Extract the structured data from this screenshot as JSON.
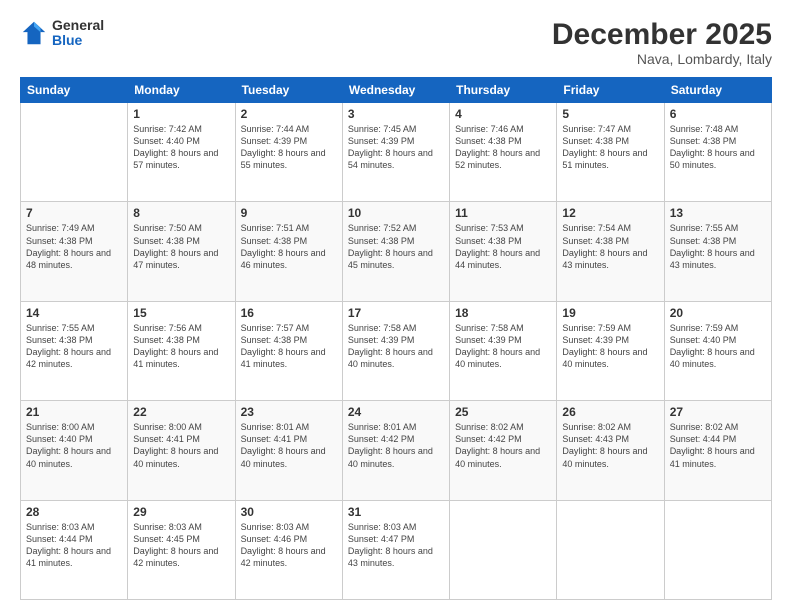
{
  "header": {
    "logo_general": "General",
    "logo_blue": "Blue",
    "month": "December 2025",
    "location": "Nava, Lombardy, Italy"
  },
  "days_of_week": [
    "Sunday",
    "Monday",
    "Tuesday",
    "Wednesday",
    "Thursday",
    "Friday",
    "Saturday"
  ],
  "weeks": [
    [
      {
        "day": "",
        "sunrise": "",
        "sunset": "",
        "daylight": ""
      },
      {
        "day": "1",
        "sunrise": "7:42 AM",
        "sunset": "4:40 PM",
        "daylight": "8 hours and 57 minutes."
      },
      {
        "day": "2",
        "sunrise": "7:44 AM",
        "sunset": "4:39 PM",
        "daylight": "8 hours and 55 minutes."
      },
      {
        "day": "3",
        "sunrise": "7:45 AM",
        "sunset": "4:39 PM",
        "daylight": "8 hours and 54 minutes."
      },
      {
        "day": "4",
        "sunrise": "7:46 AM",
        "sunset": "4:38 PM",
        "daylight": "8 hours and 52 minutes."
      },
      {
        "day": "5",
        "sunrise": "7:47 AM",
        "sunset": "4:38 PM",
        "daylight": "8 hours and 51 minutes."
      },
      {
        "day": "6",
        "sunrise": "7:48 AM",
        "sunset": "4:38 PM",
        "daylight": "8 hours and 50 minutes."
      }
    ],
    [
      {
        "day": "7",
        "sunrise": "7:49 AM",
        "sunset": "4:38 PM",
        "daylight": "8 hours and 48 minutes."
      },
      {
        "day": "8",
        "sunrise": "7:50 AM",
        "sunset": "4:38 PM",
        "daylight": "8 hours and 47 minutes."
      },
      {
        "day": "9",
        "sunrise": "7:51 AM",
        "sunset": "4:38 PM",
        "daylight": "8 hours and 46 minutes."
      },
      {
        "day": "10",
        "sunrise": "7:52 AM",
        "sunset": "4:38 PM",
        "daylight": "8 hours and 45 minutes."
      },
      {
        "day": "11",
        "sunrise": "7:53 AM",
        "sunset": "4:38 PM",
        "daylight": "8 hours and 44 minutes."
      },
      {
        "day": "12",
        "sunrise": "7:54 AM",
        "sunset": "4:38 PM",
        "daylight": "8 hours and 43 minutes."
      },
      {
        "day": "13",
        "sunrise": "7:55 AM",
        "sunset": "4:38 PM",
        "daylight": "8 hours and 43 minutes."
      }
    ],
    [
      {
        "day": "14",
        "sunrise": "7:55 AM",
        "sunset": "4:38 PM",
        "daylight": "8 hours and 42 minutes."
      },
      {
        "day": "15",
        "sunrise": "7:56 AM",
        "sunset": "4:38 PM",
        "daylight": "8 hours and 41 minutes."
      },
      {
        "day": "16",
        "sunrise": "7:57 AM",
        "sunset": "4:38 PM",
        "daylight": "8 hours and 41 minutes."
      },
      {
        "day": "17",
        "sunrise": "7:58 AM",
        "sunset": "4:39 PM",
        "daylight": "8 hours and 40 minutes."
      },
      {
        "day": "18",
        "sunrise": "7:58 AM",
        "sunset": "4:39 PM",
        "daylight": "8 hours and 40 minutes."
      },
      {
        "day": "19",
        "sunrise": "7:59 AM",
        "sunset": "4:39 PM",
        "daylight": "8 hours and 40 minutes."
      },
      {
        "day": "20",
        "sunrise": "7:59 AM",
        "sunset": "4:40 PM",
        "daylight": "8 hours and 40 minutes."
      }
    ],
    [
      {
        "day": "21",
        "sunrise": "8:00 AM",
        "sunset": "4:40 PM",
        "daylight": "8 hours and 40 minutes."
      },
      {
        "day": "22",
        "sunrise": "8:00 AM",
        "sunset": "4:41 PM",
        "daylight": "8 hours and 40 minutes."
      },
      {
        "day": "23",
        "sunrise": "8:01 AM",
        "sunset": "4:41 PM",
        "daylight": "8 hours and 40 minutes."
      },
      {
        "day": "24",
        "sunrise": "8:01 AM",
        "sunset": "4:42 PM",
        "daylight": "8 hours and 40 minutes."
      },
      {
        "day": "25",
        "sunrise": "8:02 AM",
        "sunset": "4:42 PM",
        "daylight": "8 hours and 40 minutes."
      },
      {
        "day": "26",
        "sunrise": "8:02 AM",
        "sunset": "4:43 PM",
        "daylight": "8 hours and 40 minutes."
      },
      {
        "day": "27",
        "sunrise": "8:02 AM",
        "sunset": "4:44 PM",
        "daylight": "8 hours and 41 minutes."
      }
    ],
    [
      {
        "day": "28",
        "sunrise": "8:03 AM",
        "sunset": "4:44 PM",
        "daylight": "8 hours and 41 minutes."
      },
      {
        "day": "29",
        "sunrise": "8:03 AM",
        "sunset": "4:45 PM",
        "daylight": "8 hours and 42 minutes."
      },
      {
        "day": "30",
        "sunrise": "8:03 AM",
        "sunset": "4:46 PM",
        "daylight": "8 hours and 42 minutes."
      },
      {
        "day": "31",
        "sunrise": "8:03 AM",
        "sunset": "4:47 PM",
        "daylight": "8 hours and 43 minutes."
      },
      {
        "day": "",
        "sunrise": "",
        "sunset": "",
        "daylight": ""
      },
      {
        "day": "",
        "sunrise": "",
        "sunset": "",
        "daylight": ""
      },
      {
        "day": "",
        "sunrise": "",
        "sunset": "",
        "daylight": ""
      }
    ]
  ],
  "labels": {
    "sunrise_prefix": "Sunrise: ",
    "sunset_prefix": "Sunset: ",
    "daylight_prefix": "Daylight: "
  }
}
